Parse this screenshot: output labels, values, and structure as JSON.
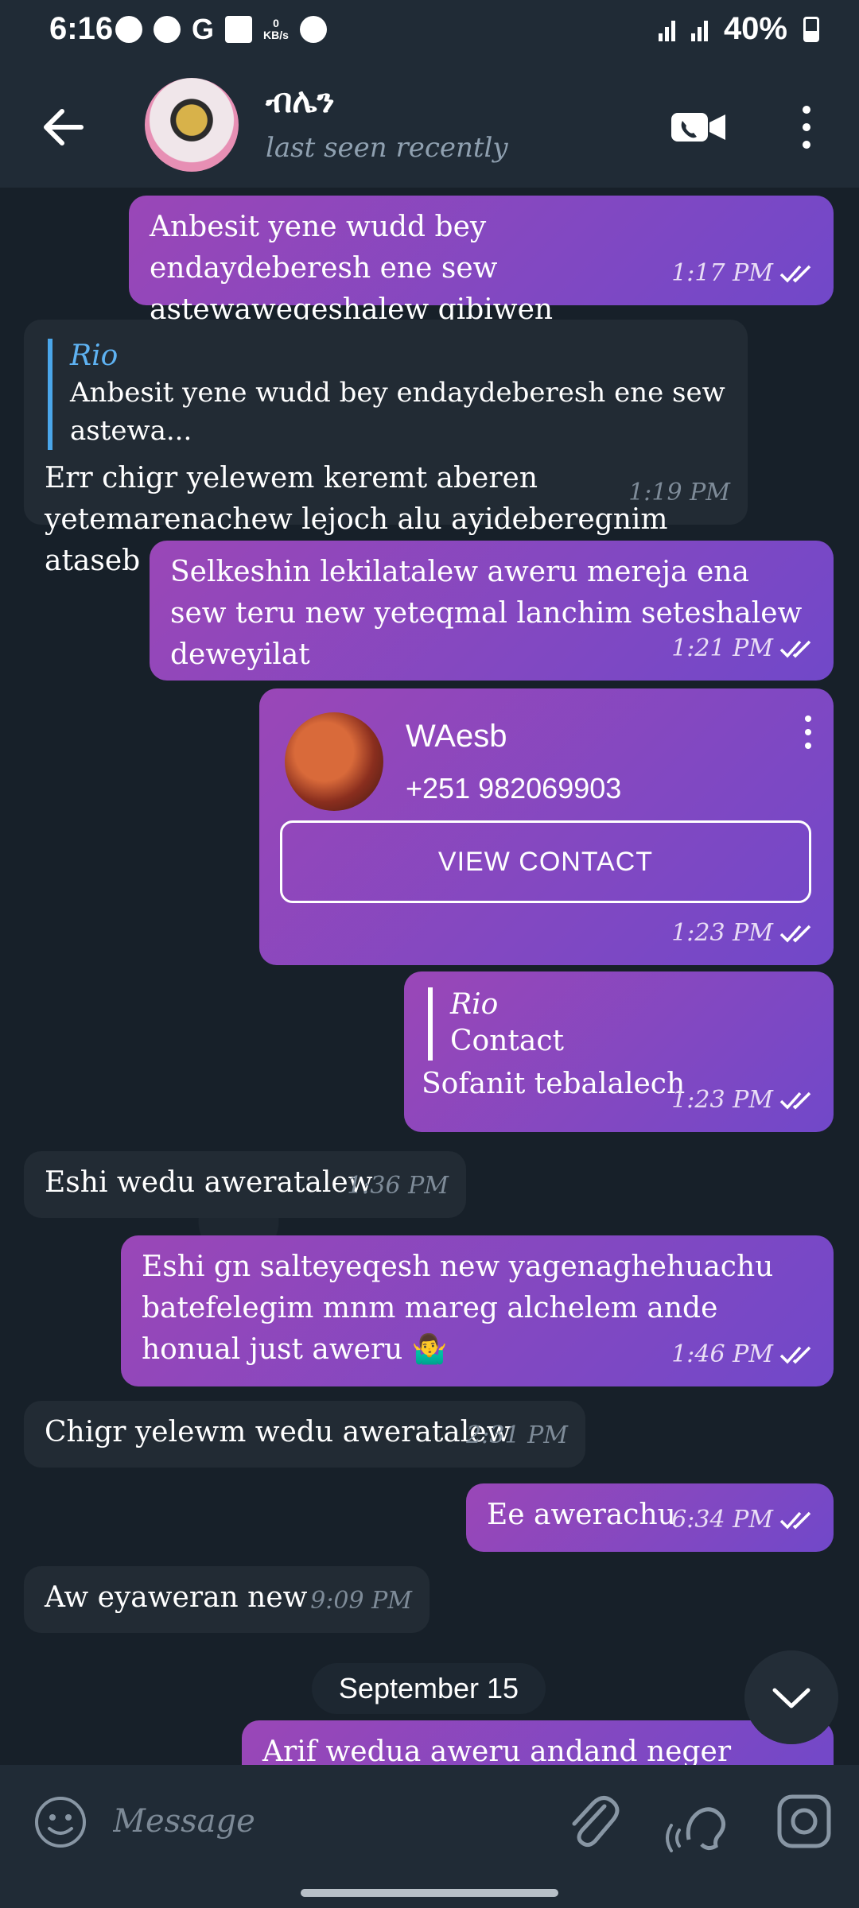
{
  "status_bar": {
    "time": "6:16",
    "data_rate_value": "0",
    "data_rate_unit": "KB/s",
    "battery": "40%"
  },
  "header": {
    "title": "ብሌን",
    "subtitle": "last seen recently"
  },
  "messages": [
    {
      "text": "Anbesit yene wudd bey endaydeberesh ene sew astewaweqeshalew gibiwen esketelemghi",
      "time": "1:17 PM"
    },
    {
      "reply_name": "Rio",
      "reply_text": "Anbesit yene wudd bey endaydeberesh ene sew astewa...",
      "text": "Err chigr yelewem keremt aberen yetemarenachew lejoch alu ayideberegnim ataseb",
      "time": "1:19 PM"
    },
    {
      "text": "Selkeshin lekilatalew aweru mereja ena sew teru new yeteqmal lanchim seteshalew deweyilat",
      "time": "1:21 PM"
    },
    {
      "contact_name": "WAesb",
      "contact_phone": "+251 982069903",
      "button": "VIEW CONTACT",
      "time": "1:23 PM"
    },
    {
      "reply_name": "Rio",
      "reply_text": "Contact",
      "text": "Sofanit tebalalech",
      "time": "1:23 PM"
    },
    {
      "text": "Eshi wedu aweratalew",
      "time": "1:36 PM"
    },
    {
      "text": "Eshi gn salteyeqesh new yagenaghehuachu batefelegim mnm mareg alchelem ande honual just aweru 🤷‍♂️",
      "time": "1:46 PM"
    },
    {
      "text": "Chigr yelewm wedu aweratalew",
      "time": "2:31 PM"
    },
    {
      "text": "Ee awerachu",
      "time": "6:34 PM"
    },
    {
      "text": "Aw eyaweran new",
      "time": "9:09 PM"
    },
    {
      "text": "Arif wedua aweru andand neger teyeqiyat",
      "time": ""
    }
  ],
  "date_separator": "September 15",
  "input": {
    "placeholder": "Message"
  },
  "colors": {
    "outgoing_start": "#9a47b7",
    "outgoing_end": "#7148c9",
    "incoming": "#222b34",
    "reply_accent": "#4aa6ea"
  }
}
